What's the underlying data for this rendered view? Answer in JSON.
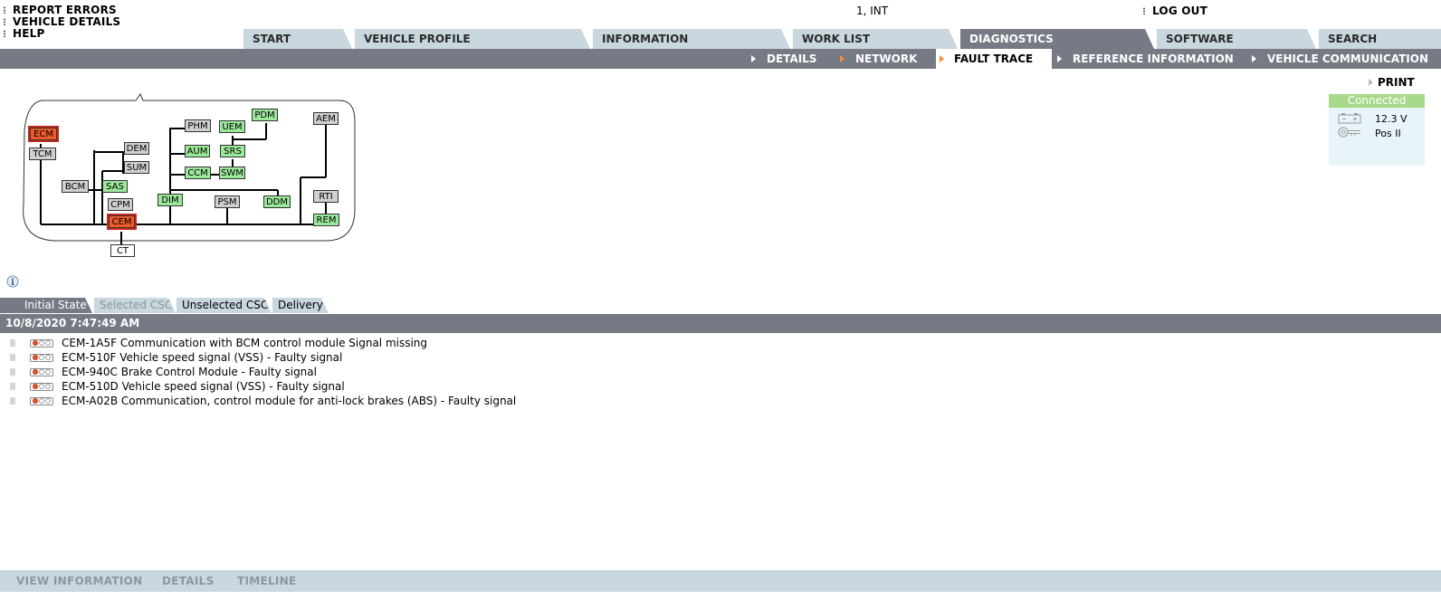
{
  "top_links": [
    "REPORT ERRORS",
    "VEHICLE DETAILS",
    "HELP"
  ],
  "user_info": "1, INT",
  "logout_label": "LOG OUT",
  "main_tabs": [
    "START",
    "VEHICLE PROFILE",
    "INFORMATION",
    "WORK LIST",
    "DIAGNOSTICS",
    "SOFTWARE",
    "SEARCH"
  ],
  "active_main_tab": "DIAGNOSTICS",
  "sub_tabs": [
    "DETAILS",
    "NETWORK",
    "FAULT TRACE",
    "REFERENCE INFORMATION",
    "VEHICLE COMMUNICATION"
  ],
  "active_sub_tab": "FAULT TRACE",
  "print_label": "PRINT",
  "connection": {
    "status": "Connected",
    "voltage": "12.3 V",
    "ignition": "Pos II",
    "status_color": "#a8d88a"
  },
  "network": {
    "modules": {
      "ecm": {
        "label": "ECM",
        "state": "fault"
      },
      "tcm": {
        "label": "TCM",
        "state": "inactive"
      },
      "dem": {
        "label": "DEM",
        "state": "inactive"
      },
      "sum": {
        "label": "SUM",
        "state": "inactive"
      },
      "bcm": {
        "label": "BCM",
        "state": "inactive"
      },
      "sas": {
        "label": "SAS",
        "state": "ok"
      },
      "cpm": {
        "label": "CPM",
        "state": "inactive"
      },
      "cem": {
        "label": "CEM",
        "state": "fault"
      },
      "ct": {
        "label": "CT",
        "state": "none"
      },
      "phm": {
        "label": "PHM",
        "state": "inactive"
      },
      "uem": {
        "label": "UEM",
        "state": "ok"
      },
      "pdm": {
        "label": "PDM",
        "state": "ok"
      },
      "aum": {
        "label": "AUM",
        "state": "ok"
      },
      "srs": {
        "label": "SRS",
        "state": "ok"
      },
      "ccm": {
        "label": "CCM",
        "state": "ok"
      },
      "swm": {
        "label": "SWM",
        "state": "ok"
      },
      "dim": {
        "label": "DIM",
        "state": "ok"
      },
      "psm": {
        "label": "PSM",
        "state": "inactive"
      },
      "ddm": {
        "label": "DDM",
        "state": "ok"
      },
      "aem": {
        "label": "AEM",
        "state": "inactive"
      },
      "rti": {
        "label": "RTI",
        "state": "inactive"
      },
      "rem": {
        "label": "REM",
        "state": "ok"
      }
    },
    "colors": {
      "fault": "#ee5a2b",
      "ok": "#9be89b",
      "inactive": "#cfcfcf"
    }
  },
  "section_tabs": [
    "Initial State",
    "Selected CSC",
    "Unselected CSC",
    "Delivery"
  ],
  "active_section_tab": "Initial State",
  "timestamp": "10/8/2020 7:47:49 AM",
  "faults": [
    "CEM-1A5F Communication with BCM control module Signal missing",
    "ECM-510F Vehicle speed signal (VSS) - Faulty signal",
    "ECM-940C Brake Control Module - Faulty signal",
    "ECM-510D Vehicle speed signal (VSS) - Faulty signal",
    "ECM-A02B Communication, control module for anti-lock brakes (ABS) - Faulty signal"
  ],
  "bottom_actions": [
    "VIEW INFORMATION",
    "DETAILS",
    "TIMELINE"
  ]
}
